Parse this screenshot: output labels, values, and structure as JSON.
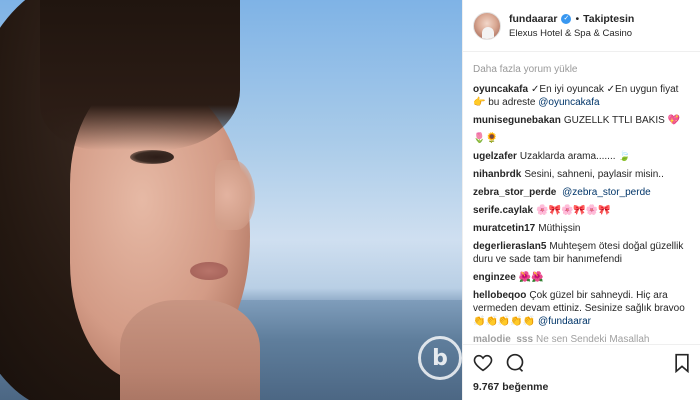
{
  "post": {
    "username": "fundaarar",
    "follow_status": "Takiptesin",
    "location": "Elexus Hotel & Spa & Casino",
    "load_more": "Daha fazla yorum yükle",
    "likes": "9.767 beğenme"
  },
  "comments": [
    {
      "user": "oyuncakafa",
      "text": "✓En iyi oyuncak ✓En uygun fiyat 👉 bu adreste",
      "mention": "@oyuncakafa"
    },
    {
      "user": "munisegunebakan",
      "text": "GUZELLK TTLI BAKIS 💖",
      "mention": ""
    },
    {
      "user": "",
      "text": "🌷🌻",
      "mention": ""
    },
    {
      "user": "ugelzafer",
      "text": "Uzaklarda arama....... 🍃",
      "mention": ""
    },
    {
      "user": "nihanbrdk",
      "text": "Sesini, sahneni, paylasir misin..",
      "mention": ""
    },
    {
      "user": "zebra_stor_perde",
      "text": "",
      "mention": "@zebra_stor_perde"
    },
    {
      "user": "serife.caylak",
      "text": "🌸🎀🌸🎀🌸🎀",
      "mention": ""
    },
    {
      "user": "muratcetin17",
      "text": "Müthişsin",
      "mention": ""
    },
    {
      "user": "degerlieraslan5",
      "text": "Muhteşem ötesi doğal güzellik duru ve sade tam bir hanımefendi",
      "mention": ""
    },
    {
      "user": "enginzee",
      "text": "🌺🌺",
      "mention": ""
    },
    {
      "user": "hellobeqoo",
      "text": "Çok güzel bir sahneydi. Hiç ara vermeden devam ettiniz. Sesinize sağlık bravoo👏👏👏👏👏",
      "mention": "@fundaarar"
    },
    {
      "user": "malodie_sss",
      "text": "Ne sen Sendeki Masallah",
      "mention": ""
    }
  ],
  "icons": {
    "verified": "✓",
    "watermark": "b",
    "like": "heart-icon",
    "comment": "comment-icon",
    "save": "bookmark-icon"
  },
  "colors": {
    "link": "#003569",
    "verified": "#3897f0",
    "muted": "#999999"
  }
}
